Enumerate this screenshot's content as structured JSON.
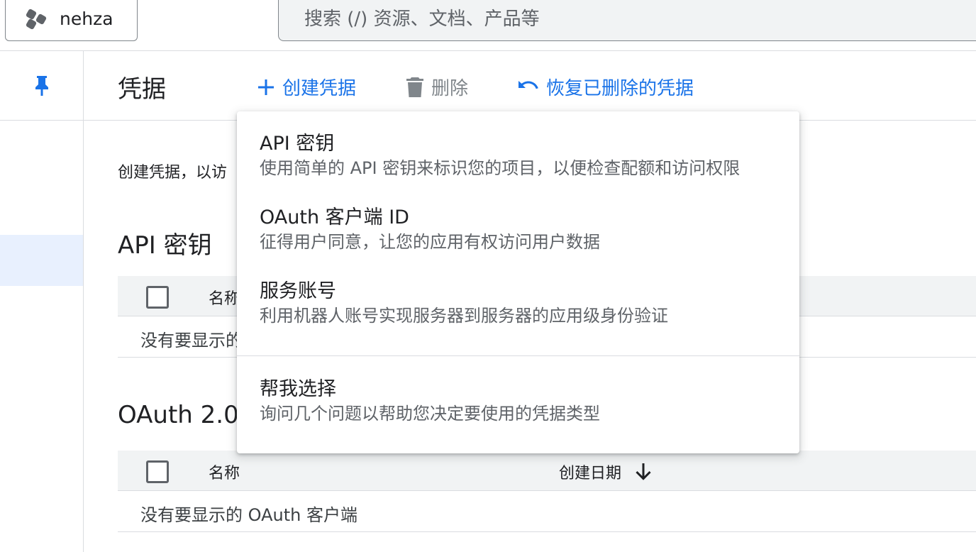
{
  "topbar": {
    "project_name": "nehza",
    "search_placeholder": "搜索 (/) 资源、文档、产品等"
  },
  "header": {
    "title": "凭据",
    "create_label": "创建凭据",
    "delete_label": "删除",
    "restore_label": "恢复已删除的凭据"
  },
  "main": {
    "intro_text": "创建凭据，以访",
    "api_keys": {
      "title": "API 密钥",
      "col_name": "名称",
      "empty_text": "没有要显示的"
    },
    "oauth": {
      "title": "OAuth 2.0",
      "col_name": "名称",
      "col_date": "创建日期",
      "empty_text": "没有要显示的 OAuth 客户端"
    }
  },
  "menu": {
    "items": [
      {
        "title": "API 密钥",
        "desc": "使用简单的 API 密钥来标识您的项目，以便检查配额和访问权限"
      },
      {
        "title": "OAuth 客户端 ID",
        "desc": "征得用户同意，让您的应用有权访问用户数据"
      },
      {
        "title": "服务账号",
        "desc": "利用机器人账号实现服务器到服务器的应用级身份验证"
      },
      {
        "title": "帮我选择",
        "desc": "询问几个问题以帮助您决定要使用的凭据类型"
      }
    ]
  },
  "colors": {
    "accent": "#1a73e8",
    "muted": "#80868b",
    "rail_highlight": "#e8f0fe",
    "table_header_bg": "#f1f3f4"
  },
  "icons": {
    "project": "hexagon-cluster-icon",
    "pin": "pin-icon",
    "create": "plus-icon",
    "delete": "trash-icon",
    "restore": "undo-icon",
    "sort": "arrow-down-icon"
  }
}
